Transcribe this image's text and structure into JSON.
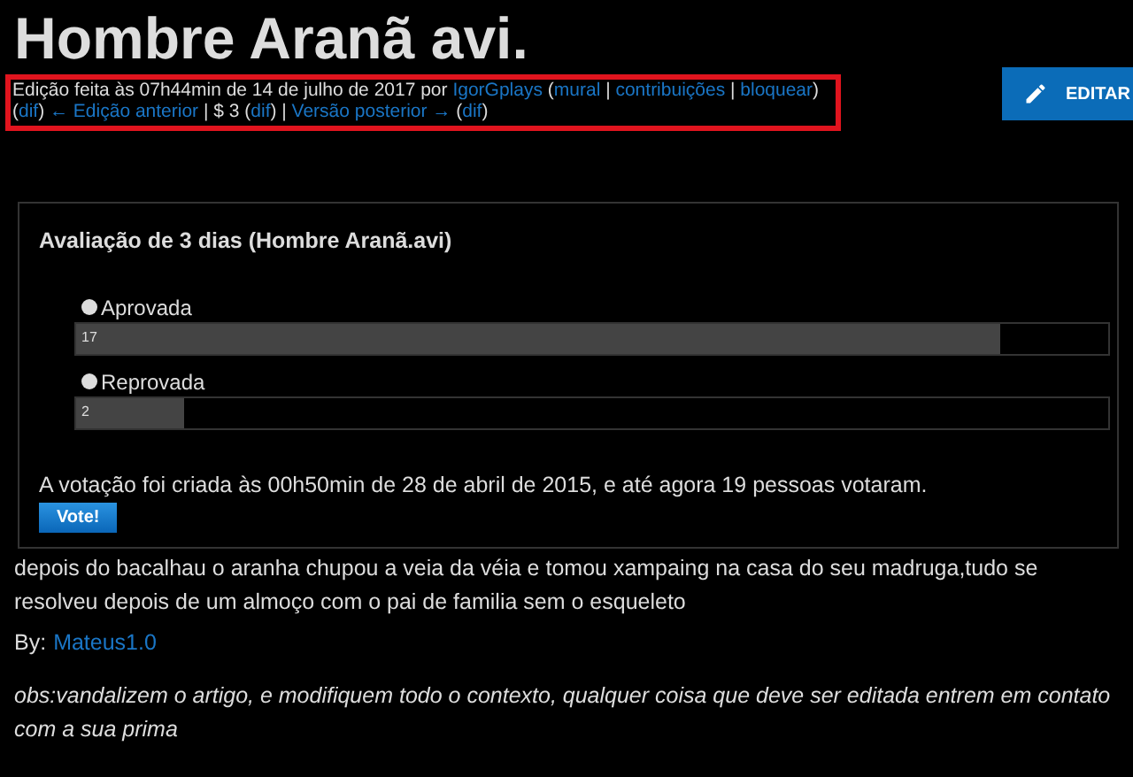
{
  "title": "Hombre Aranã avi.",
  "revision_info": {
    "lines": [
      [
        {
          "kind": "text",
          "text": "Edição feita às 07h44min de 14 de julho de 2017 por "
        },
        {
          "kind": "link",
          "text": "IgorGplays"
        },
        {
          "kind": "text",
          "text": " ("
        },
        {
          "kind": "link",
          "text": "mural"
        },
        {
          "kind": "text",
          "text": " | "
        },
        {
          "kind": "link",
          "text": "contribuições"
        },
        {
          "kind": "text",
          "text": " | "
        },
        {
          "kind": "link",
          "text": "bloquear"
        },
        {
          "kind": "text",
          "text": ")"
        }
      ],
      [
        {
          "kind": "text",
          "text": "("
        },
        {
          "kind": "link",
          "text": "dif"
        },
        {
          "kind": "text",
          "text": ") "
        },
        {
          "kind": "link",
          "text": "← Edição anterior"
        },
        {
          "kind": "text",
          "text": " | $ 3 ("
        },
        {
          "kind": "link",
          "text": "dif"
        },
        {
          "kind": "text",
          "text": ") | "
        },
        {
          "kind": "link",
          "text": "Versão posterior →"
        },
        {
          "kind": "text",
          "text": " ("
        },
        {
          "kind": "link",
          "text": "dif"
        },
        {
          "kind": "text",
          "text": ")"
        }
      ]
    ]
  },
  "edit_button": {
    "label": "EDITAR"
  },
  "poll": {
    "title": "Avaliação de 3 dias (Hombre Aranã.avi)",
    "options": [
      {
        "label": "Aprovada",
        "selected": false,
        "level": 0.895,
        "count": "17"
      },
      {
        "label": "Reprovada",
        "selected": false,
        "level": 0.105,
        "count": "2"
      }
    ],
    "summary": "A votação foi criada às 00h50min de 28 de abril de 2015, e até agora 19 pessoas votaram.",
    "vote_button": "Vote!"
  },
  "body": {
    "paragraph": "depois do bacalhau o aranha chupou a veia da véia e tomou xampaing na casa do seu madruga,tudo se resolveu depois de um almoço com o pai de familia sem o esqueleto",
    "byline_label": "By:",
    "byline_author": "Mateus1.0",
    "note": "obs:vandalizem o artigo, e modifiquem todo o contexto, qualquer coisa que deve ser editada entrem em contato com a sua prima"
  }
}
